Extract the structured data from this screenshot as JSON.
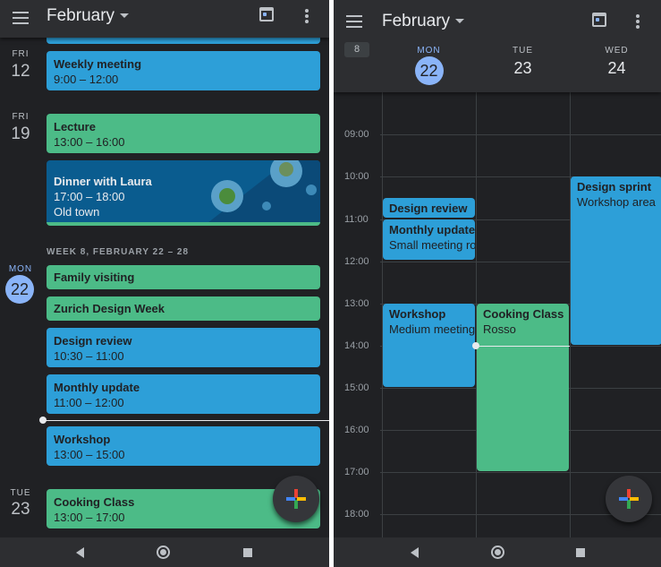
{
  "month_title": "February",
  "colors": {
    "blue_event": "#2d9fd8",
    "green_event": "#4cbb87",
    "today": "#8ab4f8",
    "background": "#202124"
  },
  "schedule_view": {
    "days": [
      {
        "weekday": "FRI",
        "day": "12",
        "events": [
          {
            "title": "Weekly meeting",
            "time": "9:00 – 12:00"
          }
        ]
      },
      {
        "weekday": "FRI",
        "day": "19",
        "events": [
          {
            "title": "Lecture",
            "time": "13:00 – 16:00"
          },
          {
            "title": "Dinner with Laura",
            "time": "17:00 – 18:00",
            "location": "Old town"
          }
        ]
      },
      {
        "weekday": "MON",
        "day": "22",
        "events": [
          {
            "title": "Family visiting"
          },
          {
            "title": "Zurich Design Week"
          },
          {
            "title": "Design review",
            "time": "10:30 – 11:00"
          },
          {
            "title": "Monthly update",
            "time": "11:00 – 12:00"
          },
          {
            "title": "Workshop",
            "time": "13:00 – 15:00"
          }
        ]
      },
      {
        "weekday": "TUE",
        "day": "23",
        "events": [
          {
            "title": "Cooking Class",
            "time": "13:00 – 17:00"
          }
        ]
      }
    ],
    "week_header": "WEEK 8, FEBRUARY 22 – 28"
  },
  "three_day_view": {
    "week_number": "8",
    "columns": [
      {
        "weekday": "MON",
        "day": "22"
      },
      {
        "weekday": "TUE",
        "day": "23"
      },
      {
        "weekday": "WED",
        "day": "24"
      }
    ],
    "hours": [
      "09:00",
      "10:00",
      "11:00",
      "12:00",
      "13:00",
      "14:00",
      "15:00",
      "16:00",
      "17:00",
      "18:00"
    ],
    "events": [
      {
        "title": "Design review",
        "location": ""
      },
      {
        "title": "Monthly update",
        "location": "Small meeting room"
      },
      {
        "title": "Workshop",
        "location": "Medium meeting room"
      },
      {
        "title": "Cooking Class",
        "location": "Rosso"
      },
      {
        "title": "Design sprint",
        "location": "Workshop area"
      }
    ]
  }
}
